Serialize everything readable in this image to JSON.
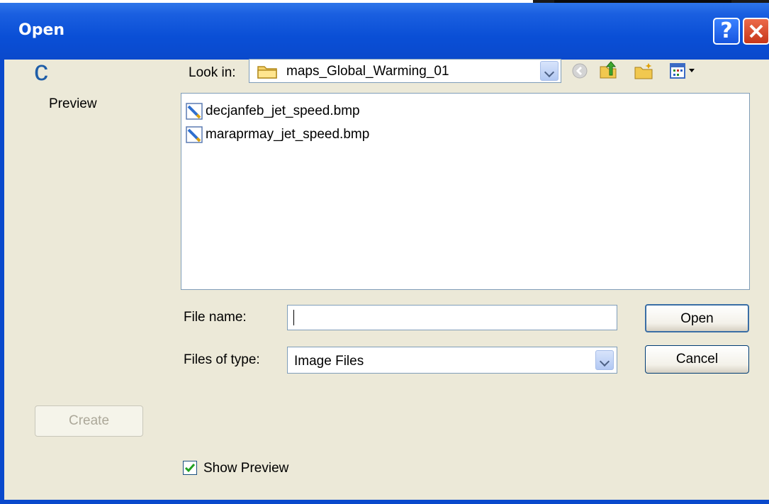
{
  "background": {
    "partial_text": "c"
  },
  "dialog": {
    "title": "Open",
    "help_glyph": "?",
    "close_glyph": "✕",
    "look_in": {
      "label": "Look in:",
      "value": "maps_Global_Warming_01",
      "folder_icon": "folder-icon"
    },
    "toolbar": {
      "icons": [
        "back-icon",
        "up-folder-icon",
        "new-folder-icon",
        "view-menu-icon"
      ]
    },
    "preview_label": "Preview",
    "files": [
      {
        "name": "decjanfeb_jet_speed.bmp",
        "icon": "bitmap-file-icon"
      },
      {
        "name": "maraprmay_jet_speed.bmp",
        "icon": "bitmap-file-icon"
      }
    ],
    "file_name": {
      "label": "File name:",
      "value": ""
    },
    "files_of_type": {
      "label": "Files of type:",
      "value": "Image Files"
    },
    "buttons": {
      "open": "Open",
      "cancel": "Cancel",
      "create": "Create"
    },
    "show_preview": {
      "label": "Show Preview",
      "checked": true
    }
  },
  "colors": {
    "titlebar": "#0a4fd6",
    "client": "#ece9d8",
    "field_border": "#7f9db9"
  }
}
